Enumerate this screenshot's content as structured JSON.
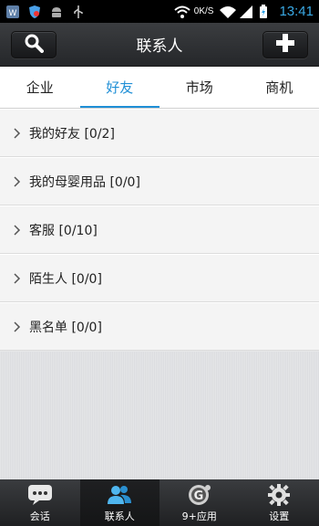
{
  "status_bar": {
    "network_speed": "0K/S",
    "time": "13:41"
  },
  "header": {
    "title": "联系人"
  },
  "tabs": [
    {
      "label": "企业",
      "active": false
    },
    {
      "label": "好友",
      "active": true
    },
    {
      "label": "市场",
      "active": false
    },
    {
      "label": "商机",
      "active": false
    }
  ],
  "groups": [
    {
      "label": "我的好友 [0/2]"
    },
    {
      "label": "我的母婴用品 [0/0]"
    },
    {
      "label": "客服 [0/10]"
    },
    {
      "label": "陌生人 [0/0]"
    },
    {
      "label": "黑名单 [0/0]"
    }
  ],
  "bottom_nav": [
    {
      "label": "会话",
      "icon": "chat-icon",
      "active": false
    },
    {
      "label": "联系人",
      "icon": "contacts-icon",
      "active": true
    },
    {
      "label": "9+应用",
      "icon": "apps-icon",
      "active": false
    },
    {
      "label": "设置",
      "icon": "gear-icon",
      "active": false
    }
  ],
  "colors": {
    "accent": "#1f8fd6",
    "time": "#3aaae6"
  }
}
